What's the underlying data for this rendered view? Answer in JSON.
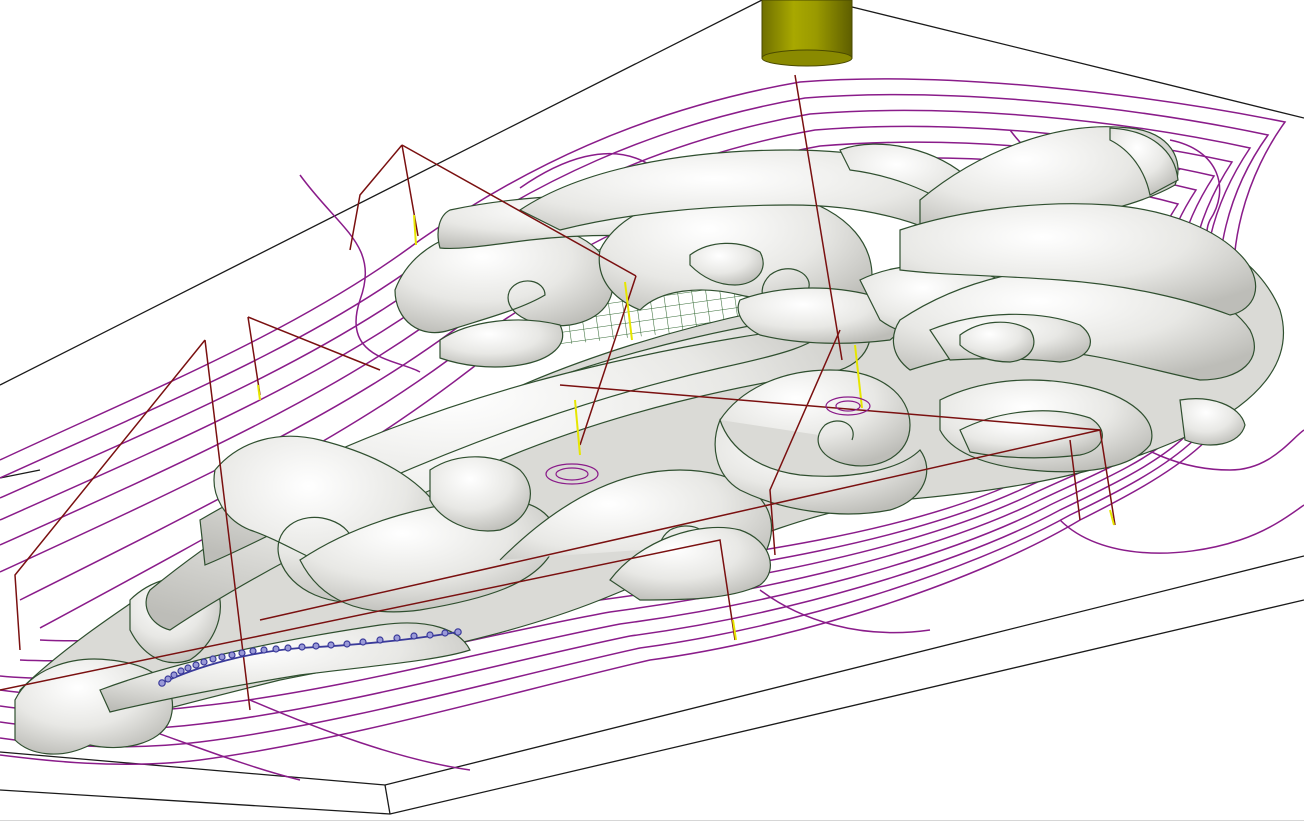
{
  "view": {
    "kind": "3d-cam-viewport",
    "background": "#ffffff"
  },
  "colors": {
    "stock_outline": "#1a1a1a",
    "model_fill": "#e9e9e6",
    "model_shadow": "#c8c8c4",
    "model_edge": "#2f4f2f",
    "roughing_toolpath": "#8a1c8a",
    "rapid_moves": "#7a1010",
    "plunge_moves": "#e6e600",
    "raster_pocket": "#1e5a1e",
    "selected_path": "#3a3a9a",
    "tool_body": "#8c8c00",
    "tool_top": "#b5b51a"
  },
  "objects": {
    "stock_box": "stock-box",
    "relief_model": "ornamental-scroll-relief",
    "tool": "end-mill-cutter",
    "toolpath": "offset-roughing-toolpath",
    "rapids": "rapid-link-moves",
    "selection": "selected-polyline"
  }
}
